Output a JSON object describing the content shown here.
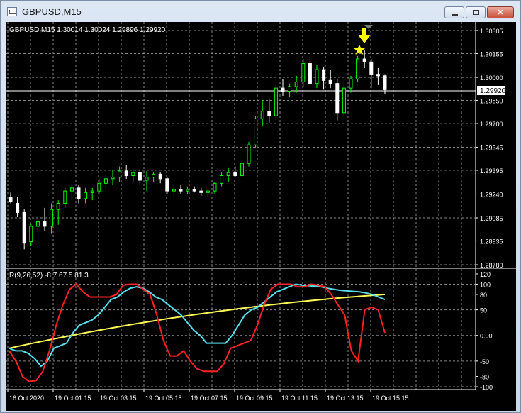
{
  "window": {
    "title": "GBPUSD,M15",
    "minimize_label": "",
    "maximize_label": "",
    "close_label": "✕"
  },
  "main_chart": {
    "header": "GBPUSD,M15  1.30014 1.30024 1.29896 1.29920",
    "current_price": "1.29920",
    "price_ticks": [
      "1.30305",
      "1.30155",
      "1.30000",
      "1.29850",
      "1.29700",
      "1.29545",
      "1.29395",
      "1.29240",
      "1.29085",
      "1.28935",
      "1.28780"
    ],
    "price_levels": [
      1.30305,
      1.30155,
      1.3,
      1.2985,
      1.297,
      1.29545,
      1.29395,
      1.2924,
      1.29085,
      1.28935,
      1.2878
    ],
    "current_value": 1.2992,
    "colors": {
      "bull": "#00ff00",
      "bear": "#ffffff",
      "grid": "#888888",
      "axis_text": "#ffffff",
      "arrow": "#ffff00",
      "star": "#ffff00"
    }
  },
  "indicator": {
    "header": "R(9,26,52) -8.7 67.5 81.3",
    "ticks": [
      "120",
      "100",
      "80",
      "50",
      "0.00",
      "-50",
      "-80",
      "-100"
    ],
    "tick_values": [
      120,
      100,
      80,
      50,
      0,
      -50,
      -80,
      -100
    ],
    "colors": {
      "red": "#ff2222",
      "cyan": "#55e0f0",
      "yellow": "#ffff55"
    }
  },
  "time_axis": {
    "labels": [
      "16 Oct 2020",
      "19 Oct 01:15",
      "19 Oct 03:15",
      "19 Oct 05:15",
      "19 Oct 07:15",
      "19 Oct 09:15",
      "19 Oct 11:15",
      "19 Oct 13:15",
      "19 Oct 15:15"
    ]
  },
  "chart_data": {
    "type": "candlestick",
    "ohlc": [
      [
        1.2922,
        1.2925,
        1.2918,
        1.2919
      ],
      [
        1.2918,
        1.2922,
        1.2909,
        1.2912
      ],
      [
        1.2912,
        1.2914,
        1.2888,
        1.2892
      ],
      [
        1.2893,
        1.2905,
        1.289,
        1.2903
      ],
      [
        1.2903,
        1.291,
        1.2899,
        1.2906
      ],
      [
        1.2906,
        1.2915,
        1.29,
        1.2903
      ],
      [
        1.2903,
        1.2918,
        1.2898,
        1.2914
      ],
      [
        1.2914,
        1.292,
        1.2904,
        1.2918
      ],
      [
        1.2918,
        1.2928,
        1.2915,
        1.2926
      ],
      [
        1.2926,
        1.2931,
        1.292,
        1.2928
      ],
      [
        1.2928,
        1.293,
        1.2918,
        1.2921
      ],
      [
        1.2921,
        1.2928,
        1.2918,
        1.2925
      ],
      [
        1.2925,
        1.2928,
        1.292,
        1.2926
      ],
      [
        1.2926,
        1.2934,
        1.2924,
        1.2931
      ],
      [
        1.2931,
        1.2937,
        1.2928,
        1.2934
      ],
      [
        1.2934,
        1.294,
        1.293,
        1.2935
      ],
      [
        1.2935,
        1.2942,
        1.2932,
        1.2939
      ],
      [
        1.2939,
        1.2943,
        1.2934,
        1.2936
      ],
      [
        1.2936,
        1.294,
        1.2932,
        1.2938
      ],
      [
        1.2938,
        1.294,
        1.293,
        1.2933
      ],
      [
        1.2933,
        1.2939,
        1.2926,
        1.2935
      ],
      [
        1.2935,
        1.2938,
        1.2932,
        1.2937
      ],
      [
        1.2937,
        1.2938,
        1.2931,
        1.2934
      ],
      [
        1.2934,
        1.2935,
        1.2924,
        1.2926
      ],
      [
        1.2926,
        1.293,
        1.2923,
        1.2927
      ],
      [
        1.2927,
        1.293,
        1.2924,
        1.2926
      ],
      [
        1.2926,
        1.2929,
        1.2924,
        1.2927
      ],
      [
        1.2927,
        1.2929,
        1.2925,
        1.2926
      ],
      [
        1.2926,
        1.2928,
        1.2923,
        1.2925
      ],
      [
        1.2925,
        1.2927,
        1.2922,
        1.2926
      ],
      [
        1.2926,
        1.2932,
        1.2924,
        1.2931
      ],
      [
        1.2931,
        1.2938,
        1.2929,
        1.2936
      ],
      [
        1.2936,
        1.2941,
        1.2932,
        1.2938
      ],
      [
        1.2938,
        1.2942,
        1.2935,
        1.2936
      ],
      [
        1.2936,
        1.2946,
        1.2935,
        1.2944
      ],
      [
        1.2944,
        1.2958,
        1.2942,
        1.2956
      ],
      [
        1.2956,
        1.2975,
        1.2954,
        1.2973
      ],
      [
        1.2973,
        1.2985,
        1.2968,
        1.2978
      ],
      [
        1.2978,
        1.2986,
        1.297,
        1.2975
      ],
      [
        1.2975,
        1.2995,
        1.2972,
        1.2993
      ],
      [
        1.2993,
        1.2999,
        1.2988,
        1.2991
      ],
      [
        1.2991,
        1.2996,
        1.2987,
        1.2994
      ],
      [
        1.2994,
        1.3001,
        1.299,
        1.2997
      ],
      [
        1.2997,
        1.3012,
        1.2994,
        1.3009
      ],
      [
        1.3009,
        1.3013,
        1.2998,
        1.2996
      ],
      [
        1.2996,
        1.3008,
        1.2993,
        1.3005
      ],
      [
        1.3005,
        1.3007,
        1.2992,
        1.2998
      ],
      [
        1.2998,
        1.3005,
        1.2993,
        1.2996
      ],
      [
        1.2996,
        1.2999,
        1.2972,
        1.2977
      ],
      [
        1.2977,
        1.2998,
        1.2975,
        1.2993
      ],
      [
        1.2993,
        1.3001,
        1.299,
        1.2999
      ],
      [
        1.2999,
        1.3014,
        1.2997,
        1.3012
      ],
      [
        1.3012,
        1.3018,
        1.3006,
        1.301
      ],
      [
        1.301,
        1.3012,
        1.2993,
        1.3002
      ],
      [
        1.3002,
        1.3006,
        1.2995,
        1.3001
      ],
      [
        1.3001,
        1.3002,
        1.2989,
        1.2992
      ]
    ],
    "indicator_series": {
      "red": [
        -30,
        -50,
        -80,
        -90,
        -88,
        -70,
        -30,
        20,
        60,
        90,
        100,
        85,
        75,
        75,
        75,
        75,
        80,
        98,
        100,
        100,
        90,
        80,
        40,
        -10,
        -40,
        -40,
        -30,
        -50,
        -65,
        -70,
        -70,
        -70,
        -55,
        -25,
        -20,
        -15,
        -10,
        20,
        60,
        90,
        100,
        100,
        100,
        95,
        95,
        100,
        98,
        95,
        80,
        60,
        40,
        -30,
        -50,
        50,
        55,
        50,
        5
      ],
      "cyan": [
        -25,
        -30,
        -30,
        -35,
        -45,
        -60,
        -50,
        -25,
        -20,
        -15,
        5,
        20,
        25,
        30,
        40,
        55,
        70,
        75,
        85,
        92,
        95,
        92,
        85,
        75,
        70,
        60,
        50,
        40,
        25,
        10,
        0,
        -15,
        -15,
        -15,
        -15,
        0,
        20,
        40,
        50,
        55,
        65,
        75,
        85,
        90,
        95,
        100,
        98,
        97,
        96,
        95,
        92,
        90,
        88,
        87,
        86,
        85,
        83,
        80,
        75,
        70
      ]
    }
  }
}
